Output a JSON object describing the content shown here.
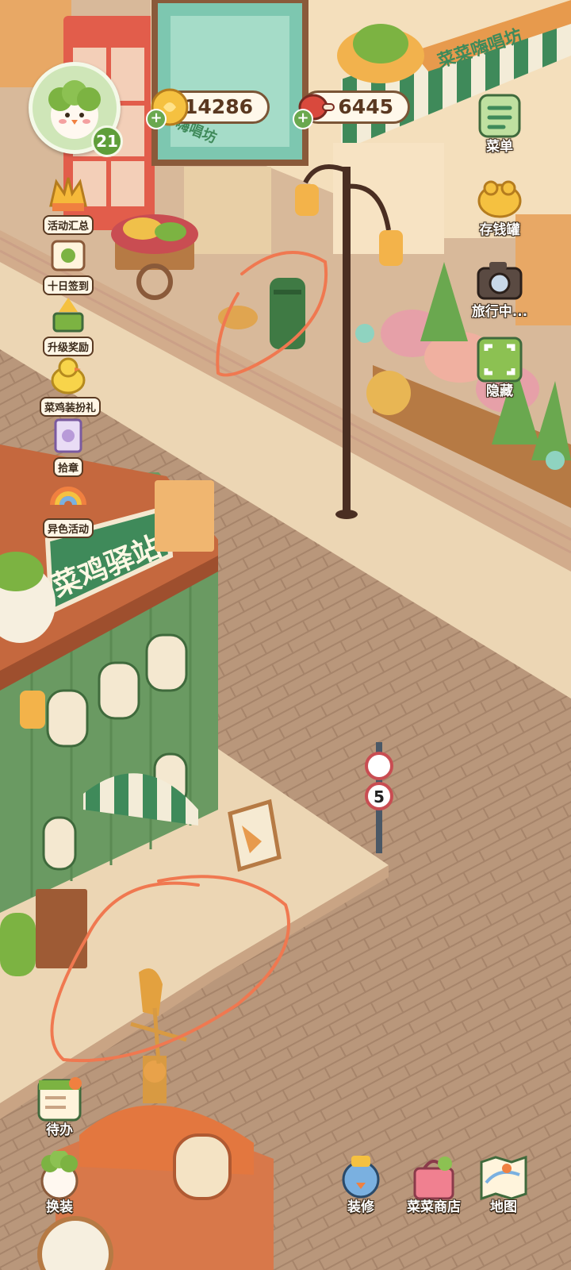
{
  "hud": {
    "player_level": "21",
    "coins": "14286",
    "meat": "6445"
  },
  "left_menu": [
    {
      "label": "活动汇总",
      "icon": "event-summary-icon"
    },
    {
      "label": "十日签到",
      "icon": "ten-day-checkin-icon"
    },
    {
      "label": "升级奖励",
      "icon": "level-reward-icon"
    },
    {
      "label": "菜鸡装扮礼",
      "icon": "chick-outfit-gift-icon"
    },
    {
      "label": "拾章",
      "icon": "stamp-icon"
    },
    {
      "label": "异色活动",
      "icon": "color-event-icon"
    }
  ],
  "right_menu": [
    {
      "label": "菜单",
      "icon": "menu-icon"
    },
    {
      "label": "存钱罐",
      "icon": "piggy-bank-icon"
    },
    {
      "label": "旅行中...",
      "icon": "camera-icon"
    },
    {
      "label": "隐藏",
      "icon": "hide-ui-icon"
    }
  ],
  "bottom_left": [
    {
      "label": "待办",
      "icon": "todo-icon"
    },
    {
      "label": "换装",
      "icon": "outfit-icon"
    }
  ],
  "bottom_right": [
    {
      "label": "装修",
      "icon": "decorate-icon"
    },
    {
      "label": "菜菜商店",
      "icon": "shop-icon"
    },
    {
      "label": "地图",
      "icon": "map-icon"
    }
  ],
  "scene": {
    "station_sign": "菜鸡驿站",
    "karaoke_sign": "菜菜嗨唱坊",
    "karaoke_sign_small": "嗨唱坊",
    "speed_sign": "5"
  },
  "colors": {
    "road": "#b8967a",
    "sidewalk": "#e8d2ae",
    "building_green": "#6a9a62",
    "annotation": "#f07850"
  }
}
